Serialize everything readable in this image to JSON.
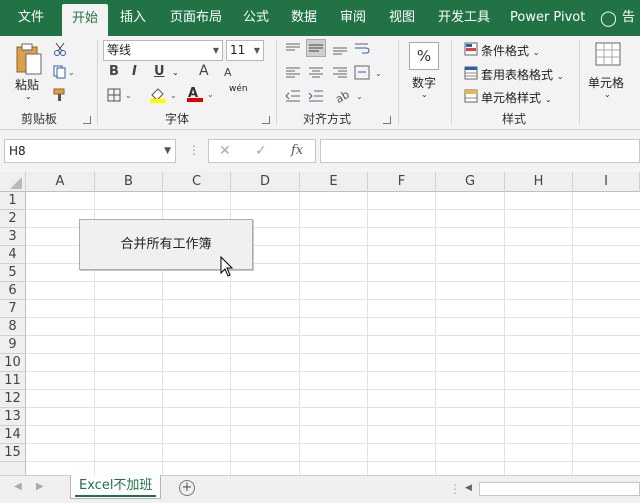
{
  "ribbon_tabs": [
    {
      "label": "文件"
    },
    {
      "label": "开始"
    },
    {
      "label": "插入"
    },
    {
      "label": "页面布局"
    },
    {
      "label": "公式"
    },
    {
      "label": "数据"
    },
    {
      "label": "审阅"
    },
    {
      "label": "视图"
    },
    {
      "label": "开发工具"
    },
    {
      "label": "Power Pivot"
    },
    {
      "label": "告"
    }
  ],
  "clipboard": {
    "paste_label": "粘贴",
    "group_label": "剪贴板"
  },
  "font": {
    "name": "等线",
    "size": "11",
    "group_label": "字体",
    "bold": "B",
    "italic": "I",
    "underline": "U",
    "grow": "A",
    "shrink": "A",
    "phonetic": "wén"
  },
  "alignment": {
    "group_label": "对齐方式"
  },
  "number": {
    "percent": "%",
    "label": "数字",
    "group_label": ""
  },
  "styles": {
    "conditional": "条件格式",
    "table": "套用表格格式",
    "cell": "单元格样式",
    "group_label": "样式"
  },
  "cells": {
    "label": "单元格"
  },
  "formula_bar": {
    "name_box": "H8",
    "fx": "fx",
    "formula": ""
  },
  "columns": [
    "A",
    "B",
    "C",
    "D",
    "E",
    "F",
    "G",
    "H",
    "I"
  ],
  "rows": [
    "1",
    "2",
    "3",
    "4",
    "5",
    "6",
    "7",
    "8",
    "9",
    "10",
    "11",
    "12",
    "13",
    "14",
    "15"
  ],
  "macro_button": {
    "label": "合并所有工作簿"
  },
  "sheets": {
    "active": "Excel不加班",
    "add": "+"
  },
  "colors": {
    "accent": "#217346",
    "font_highlight": "#ffff00",
    "font_color": "#e00000"
  }
}
